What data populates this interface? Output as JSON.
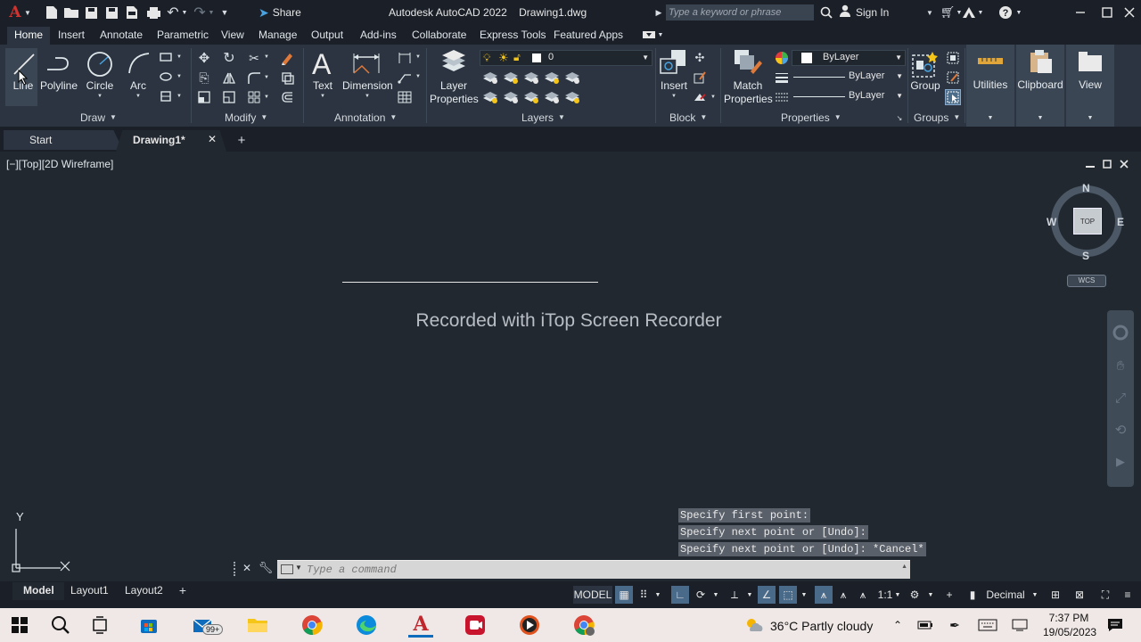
{
  "title_bar": {
    "share": "Share",
    "app_title": "Autodesk AutoCAD 2022",
    "file_name": "Drawing1.dwg",
    "search_placeholder": "Type a keyword or phrase",
    "sign_in": "Sign In"
  },
  "ribbon_tabs": [
    "Home",
    "Insert",
    "Annotate",
    "Parametric",
    "View",
    "Manage",
    "Output",
    "Add-ins",
    "Collaborate",
    "Express Tools",
    "Featured Apps"
  ],
  "ribbon": {
    "draw": {
      "title": "Draw",
      "tools": [
        "Line",
        "Polyline",
        "Circle",
        "Arc"
      ]
    },
    "modify": {
      "title": "Modify"
    },
    "annotation": {
      "title": "Annotation",
      "text": "Text",
      "dimension": "Dimension"
    },
    "layers": {
      "title": "Layers",
      "layer_properties_1": "Layer",
      "layer_properties_2": "Properties",
      "current_layer": "0"
    },
    "block": {
      "title": "Block",
      "insert": "Insert"
    },
    "properties": {
      "title": "Properties",
      "match_1": "Match",
      "match_2": "Properties",
      "color": "ByLayer",
      "linetype": "ByLayer",
      "lineweight": "ByLayer"
    },
    "groups": {
      "title": "Groups",
      "group": "Group"
    },
    "utilities": "Utilities",
    "clipboard": "Clipboard",
    "view": "View"
  },
  "file_tabs": {
    "start": "Start",
    "active": "Drawing1*"
  },
  "viewport": {
    "label": "[−][Top][2D Wireframe]",
    "watermark": "Recorded with iTop Screen Recorder",
    "viewcube": {
      "n": "N",
      "s": "S",
      "e": "E",
      "w": "W",
      "face": "TOP",
      "ucs": "WCS"
    },
    "ucs_y": "Y"
  },
  "command_history": [
    "Specify first point:",
    "Specify next point or [Undo]:",
    "Specify next point or [Undo]: *Cancel*"
  ],
  "command_placeholder": "Type a command",
  "layout_tabs": [
    "Model",
    "Layout1",
    "Layout2"
  ],
  "status_bar": {
    "model": "MODEL",
    "scale": "1:1",
    "units": "Decimal"
  },
  "taskbar": {
    "mail_badge": "99+",
    "weather": "36°C  Partly cloudy",
    "time": "7:37 PM",
    "date": "19/05/2023"
  },
  "colors": {
    "accent": "#0696d7",
    "autocad_red": "#c0272d",
    "canvas": "#212830",
    "ribbon": "#2b3440"
  }
}
